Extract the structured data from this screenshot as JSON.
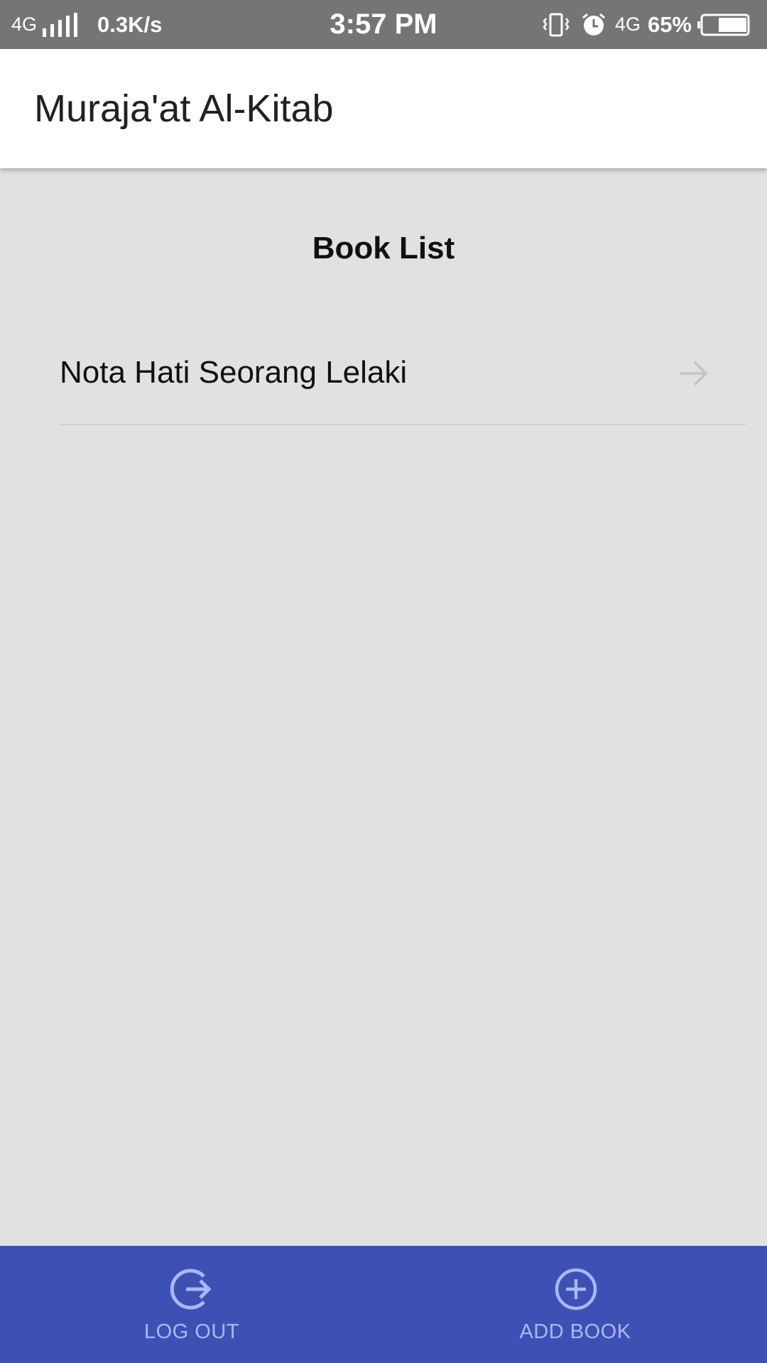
{
  "status_bar": {
    "network_left": "4G",
    "speed": "0.3K/s",
    "time": "3:57 PM",
    "network_right": "4G",
    "battery": "65%",
    "battery_level": 0.65
  },
  "app_bar": {
    "title": "Muraja'at Al-Kitab"
  },
  "main": {
    "section_title": "Book List",
    "books": [
      {
        "title": "Nota Hati Seorang Lelaki",
        "icon": "arrow-right-icon"
      }
    ]
  },
  "bottom_nav": {
    "items": [
      {
        "label": "LOG OUT",
        "icon": "logout-icon"
      },
      {
        "label": "ADD BOOK",
        "icon": "add-circle-icon"
      }
    ]
  },
  "colors": {
    "status_bar": "#757575",
    "background": "#e1e1e1",
    "bottom_nav": "#3d51b4",
    "nav_item": "#aab7ff"
  }
}
